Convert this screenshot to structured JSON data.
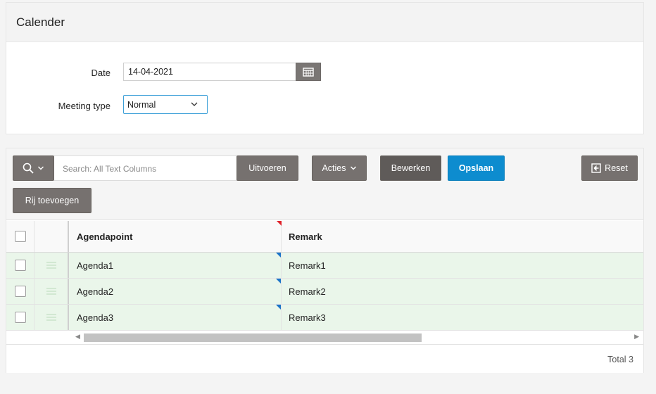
{
  "calendar": {
    "title": "Calender",
    "date_label": "Date",
    "date_value": "14-04-2021",
    "meeting_type_label": "Meeting type",
    "meeting_type_value": "Normal"
  },
  "toolbar": {
    "search_placeholder": "Search: All Text Columns",
    "run_label": "Uitvoeren",
    "actions_label": "Acties",
    "edit_label": "Bewerken",
    "save_label": "Opslaan",
    "reset_label": "Reset",
    "add_row_label": "Rij toevoegen"
  },
  "grid": {
    "columns": [
      "Agendapoint",
      "Remark"
    ],
    "rows": [
      {
        "agendapoint": "Agenda1",
        "remark": "Remark1"
      },
      {
        "agendapoint": "Agenda2",
        "remark": "Remark2"
      },
      {
        "agendapoint": "Agenda3",
        "remark": "Remark3"
      }
    ],
    "total": "Total 3"
  },
  "colors": {
    "primary_button": "#0d8ccf",
    "gray_button": "#76716f",
    "row_changed": "#eaf6ea",
    "changed_marker": "#1a73c8",
    "error_marker": "#e0222a"
  }
}
